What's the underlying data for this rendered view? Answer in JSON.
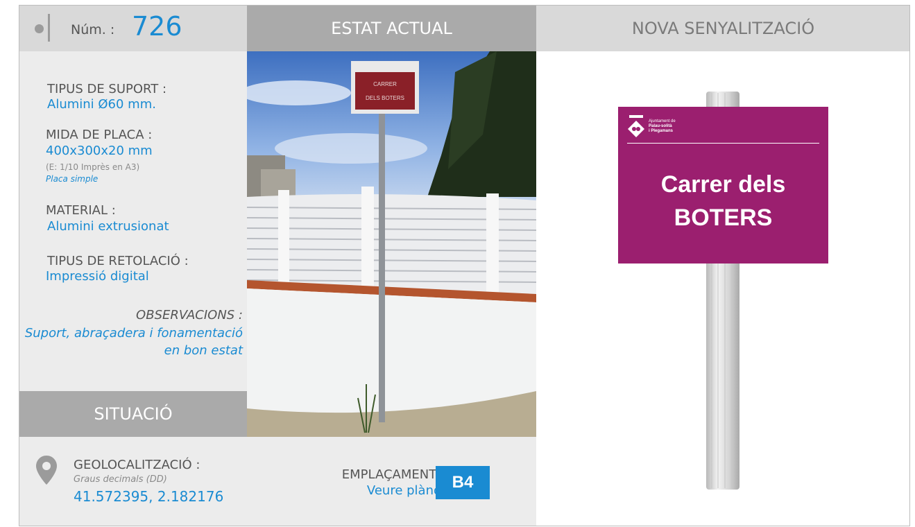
{
  "header": {
    "number_label": "Núm. :",
    "number_value": "726",
    "current_state_title": "ESTAT ACTUAL",
    "new_signage_title": "NOVA SENYALITZACIÓ"
  },
  "info": {
    "support_type_label": "TIPUS DE SUPORT :",
    "support_type_value": "Alumini Ø60 mm.",
    "plate_size_label": "MIDA DE PLACA :",
    "plate_size_value": "400x300x20 mm",
    "plate_size_scale": "(E: 1/10 Imprès en A3)",
    "plate_type": "Placa simple",
    "material_label": "MATERIAL :",
    "material_value": "Alumini extrusionat",
    "lettering_label": "TIPUS DE RETOLACIÓ :",
    "lettering_value": "Impressió digital",
    "observations_label": "OBSERVACIONS :",
    "observations_value": "Suport, abraçadera i fonamentació en bon estat"
  },
  "situation": {
    "title": "SITUACIÓ",
    "geo_label": "GEOLOCALITZACIÓ :",
    "geo_format": "Graus decimals (DD)",
    "geo_value": "41.572395, 2.182176",
    "placement_label": "EMPLAÇAMENT :",
    "placement_link": "Veure plànol",
    "grid_ref": "B4"
  },
  "photo": {
    "sign_line1": "CARRER",
    "sign_line2": "DELS BOTERS"
  },
  "new_sign": {
    "org_line1": "Ajuntament de",
    "org_line2": "Palau-solità",
    "org_line3": "i Plegamans",
    "street_line1": "Carrer dels",
    "street_line2": "BOTERS",
    "plate_color": "#9b1f6f"
  },
  "colors": {
    "accent": "#1a8bd2",
    "header_gray": "#aaaaaa",
    "light_gray": "#d9d9d9"
  }
}
